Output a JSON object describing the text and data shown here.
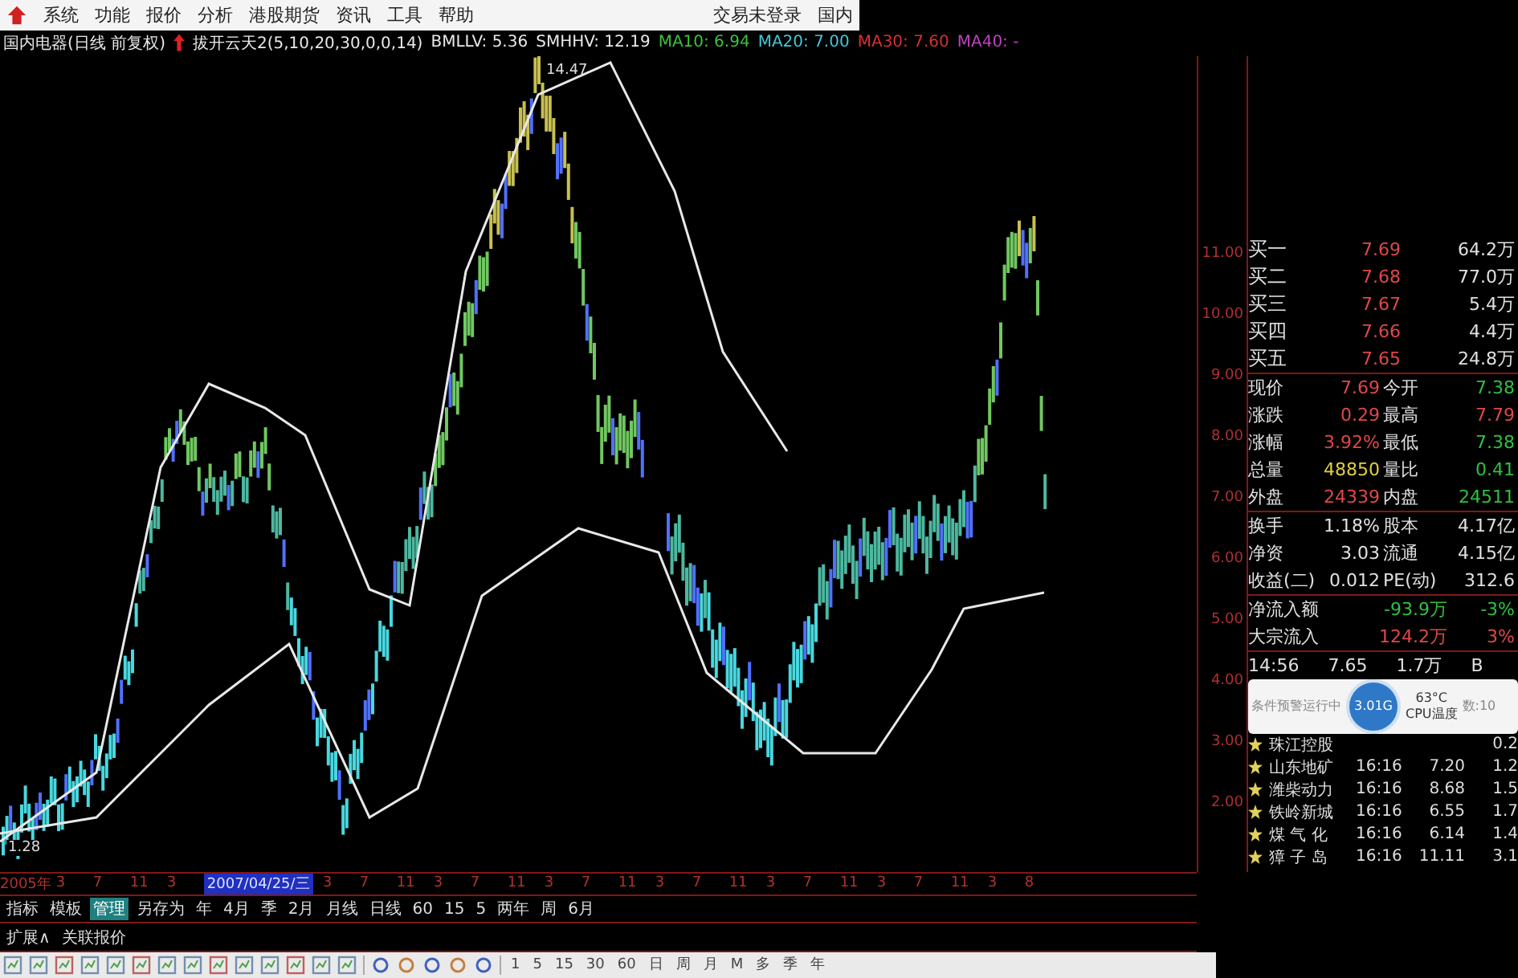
{
  "menu_bar": {
    "items": [
      "系统",
      "功能",
      "报价",
      "分析",
      "港股期货",
      "资讯",
      "工具",
      "帮助"
    ],
    "right_items": [
      "交易未登录",
      "国内"
    ]
  },
  "indicator_bar": {
    "stock": "国内电器(日线 前复权)",
    "formula": "拔开云天2(5,10,20,30,0,0,14)",
    "values": [
      "BMLLV: 5.36",
      "SMHHV: 12.19"
    ],
    "moving_averages": [
      {
        "label": "MA10: 6.94",
        "color": "#3cc03c"
      },
      {
        "label": "MA20: 7.00",
        "color": "#40c8d8"
      },
      {
        "label": "MA30: 7.60",
        "color": "#d83030"
      },
      {
        "label": "MA40: -",
        "color": "#c040c0"
      }
    ]
  },
  "chart": {
    "high_label": "14.47",
    "low_label": "1.28",
    "price_axis": [
      "11.00",
      "10.00",
      "9.00",
      "8.00",
      "7.00",
      "6.00",
      "5.00",
      "4.00",
      "3.00",
      "2.00"
    ],
    "time_axis": [
      {
        "label": "2005年",
        "selected": false
      },
      {
        "label": "3",
        "selected": false
      },
      {
        "label": "7",
        "selected": false
      },
      {
        "label": "11",
        "selected": false
      },
      {
        "label": "3",
        "selected": false
      },
      {
        "label": "2007/04/25/三",
        "selected": true
      },
      {
        "label": "3",
        "selected": false
      },
      {
        "label": "7",
        "selected": false
      },
      {
        "label": "11",
        "selected": false
      },
      {
        "label": "3",
        "selected": false
      },
      {
        "label": "7",
        "selected": false
      },
      {
        "label": "11",
        "selected": false
      },
      {
        "label": "3",
        "selected": false
      },
      {
        "label": "7",
        "selected": false
      },
      {
        "label": "11",
        "selected": false
      },
      {
        "label": "3",
        "selected": false
      },
      {
        "label": "7",
        "selected": false
      },
      {
        "label": "11",
        "selected": false
      },
      {
        "label": "3",
        "selected": false
      },
      {
        "label": "7",
        "selected": false
      },
      {
        "label": "11",
        "selected": false
      },
      {
        "label": "3",
        "selected": false
      },
      {
        "label": "7",
        "selected": false
      },
      {
        "label": "11",
        "selected": false
      },
      {
        "label": "3",
        "selected": false
      },
      {
        "label": "8",
        "selected": false
      }
    ]
  },
  "quote": {
    "bids": [
      {
        "name": "买一",
        "price": "7.69",
        "volume": "64.2万"
      },
      {
        "name": "买二",
        "price": "7.68",
        "volume": "77.0万"
      },
      {
        "name": "买三",
        "price": "7.67",
        "volume": "5.4万"
      },
      {
        "name": "买四",
        "price": "7.66",
        "volume": "4.4万"
      },
      {
        "name": "买五",
        "price": "7.65",
        "volume": "24.8万"
      }
    ],
    "stats": [
      {
        "label": "现价",
        "value": "7.69",
        "color": "#e04848"
      },
      {
        "label": "今开",
        "value": "7.38",
        "color": "#30c040"
      },
      {
        "label": "涨跌",
        "value": "0.29",
        "color": "#e04848"
      },
      {
        "label": "最高",
        "value": "7.79",
        "color": "#e04848"
      },
      {
        "label": "涨幅",
        "value": "3.92%",
        "color": "#e04848"
      },
      {
        "label": "最低",
        "value": "7.38",
        "color": "#30c040"
      },
      {
        "label": "总量",
        "value": "48850",
        "color": "#e0d040"
      },
      {
        "label": "量比",
        "value": "0.41",
        "color": "#30c040"
      },
      {
        "label": "外盘",
        "value": "24339",
        "color": "#e04848"
      },
      {
        "label": "内盘",
        "value": "24511",
        "color": "#30c040"
      }
    ],
    "finance": [
      {
        "label": "换手",
        "value": "1.18%"
      },
      {
        "label": "股本",
        "value": "4.17亿"
      },
      {
        "label": "净资",
        "value": "3.03"
      },
      {
        "label": "流通",
        "value": "4.15亿"
      },
      {
        "label": "收益(二)",
        "value": "0.012"
      },
      {
        "label": "PE(动)",
        "value": "312.6"
      }
    ],
    "flows": [
      {
        "label": "净流入额",
        "amount": "-93.9万",
        "percent": "-3%",
        "color": "#30c040"
      },
      {
        "label": "大宗流入",
        "amount": "124.2万",
        "percent": "3%",
        "color": "#e04848"
      }
    ],
    "tick": [
      "14:56",
      "7.65",
      "1.7万",
      "B"
    ]
  },
  "watchlist": [
    {
      "name": "珠江控股",
      "extra": "0.2"
    },
    {
      "name": "山东地矿",
      "time": "16:16",
      "price": "7.20",
      "extra": "1.2"
    },
    {
      "name": "潍柴动力",
      "time": "16:16",
      "price": "8.68",
      "extra": "1.5"
    },
    {
      "name": "铁岭新城",
      "time": "16:16",
      "price": "6.55",
      "extra": "1.7"
    },
    {
      "name": "煤 气 化",
      "time": "16:16",
      "price": "6.14",
      "extra": "1.4"
    },
    {
      "name": "獐 子 岛",
      "time": "16:16",
      "price": "11.11",
      "extra": "3.1"
    }
  ],
  "popup": {
    "status": "条件预警运行中",
    "memory": "3.01G",
    "temperature": "63°C",
    "temperature_label": "CPU温度",
    "count": "数:10"
  },
  "period_bar": [
    {
      "label": "指标",
      "selected": false
    },
    {
      "label": "模板",
      "selected": false
    },
    {
      "label": "管理",
      "selected": true
    },
    {
      "label": "另存为",
      "selected": false
    },
    {
      "label": "年",
      "selected": false
    },
    {
      "label": "4月",
      "selected": false
    },
    {
      "label": "季",
      "selected": false
    },
    {
      "label": "2月",
      "selected": false
    },
    {
      "label": "月线",
      "selected": false
    },
    {
      "label": "日线",
      "selected": false
    },
    {
      "label": "60",
      "selected": false
    },
    {
      "label": "15",
      "selected": false
    },
    {
      "label": "5",
      "selected": false
    },
    {
      "label": "两年",
      "selected": false
    },
    {
      "label": "周",
      "selected": false
    },
    {
      "label": "6月",
      "selected": false
    }
  ],
  "expand_bar": [
    "扩展∧",
    "关联报价"
  ],
  "toolbar": {
    "periods": [
      "1",
      "5",
      "15",
      "30",
      "60",
      "日",
      "周",
      "月",
      "M",
      "多",
      "季",
      "年"
    ]
  }
}
